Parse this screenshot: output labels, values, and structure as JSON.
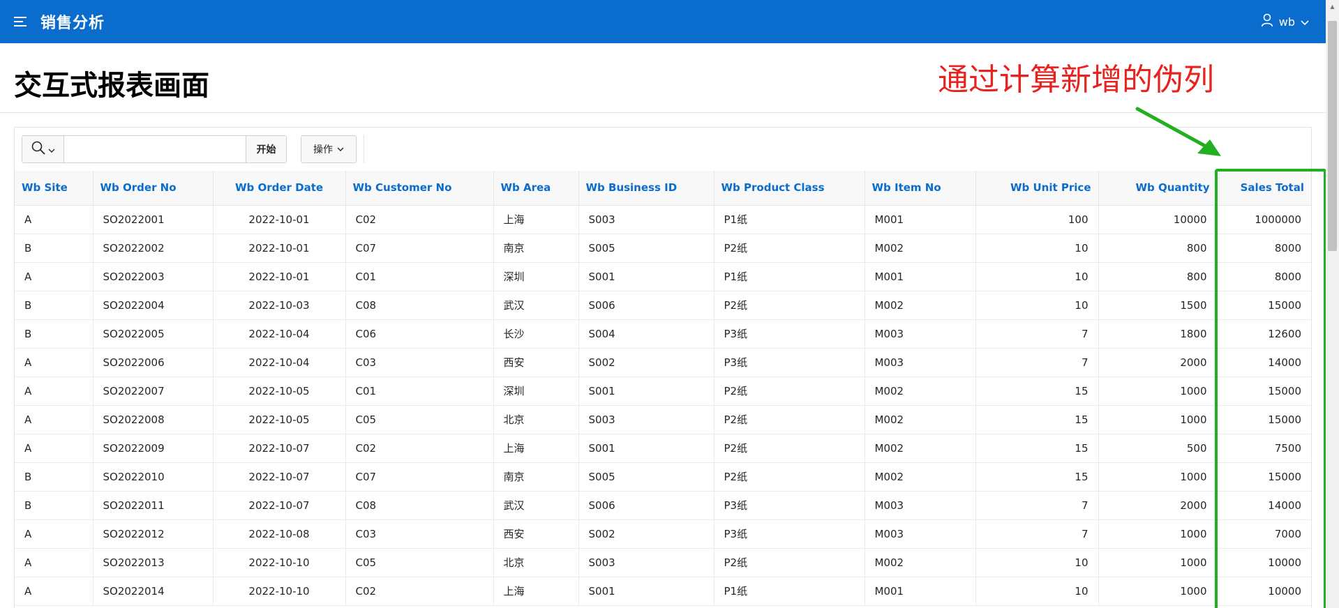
{
  "header": {
    "app_title": "销售分析",
    "menu_icon": "hamburger-menu-icon",
    "user_icon": "user-icon",
    "user_name": "wb",
    "accent_color": "#0a6dcd"
  },
  "page": {
    "title": "交互式报表画面"
  },
  "annotation": {
    "text": "通过计算新增的伪列",
    "text_color": "#e8221f",
    "highlight_color": "#22b022"
  },
  "toolbar": {
    "search_icon": "search-icon",
    "search_value": "",
    "go_label": "开始",
    "actions_label": "操作"
  },
  "table": {
    "columns": [
      {
        "label": "Wb Site",
        "align": "left"
      },
      {
        "label": "Wb Order No",
        "align": "left"
      },
      {
        "label": "Wb Order Date",
        "align": "center"
      },
      {
        "label": "Wb Customer No",
        "align": "left"
      },
      {
        "label": "Wb Area",
        "align": "left"
      },
      {
        "label": "Wb Business ID",
        "align": "left"
      },
      {
        "label": "Wb Product Class",
        "align": "left"
      },
      {
        "label": "Wb Item No",
        "align": "left"
      },
      {
        "label": "Wb Unit Price",
        "align": "right"
      },
      {
        "label": "Wb Quantity",
        "align": "right"
      },
      {
        "label": "Sales Total",
        "align": "right"
      }
    ],
    "rows": [
      [
        "A",
        "SO2022001",
        "2022-10-01",
        "C02",
        "上海",
        "S003",
        "P1纸",
        "M001",
        "100",
        "10000",
        "1000000"
      ],
      [
        "B",
        "SO2022002",
        "2022-10-01",
        "C07",
        "南京",
        "S005",
        "P2纸",
        "M002",
        "10",
        "800",
        "8000"
      ],
      [
        "A",
        "SO2022003",
        "2022-10-01",
        "C01",
        "深圳",
        "S001",
        "P1纸",
        "M001",
        "10",
        "800",
        "8000"
      ],
      [
        "B",
        "SO2022004",
        "2022-10-03",
        "C08",
        "武汉",
        "S006",
        "P2纸",
        "M002",
        "10",
        "1500",
        "15000"
      ],
      [
        "B",
        "SO2022005",
        "2022-10-04",
        "C06",
        "长沙",
        "S004",
        "P3纸",
        "M003",
        "7",
        "1800",
        "12600"
      ],
      [
        "A",
        "SO2022006",
        "2022-10-04",
        "C03",
        "西安",
        "S002",
        "P3纸",
        "M003",
        "7",
        "2000",
        "14000"
      ],
      [
        "A",
        "SO2022007",
        "2022-10-05",
        "C01",
        "深圳",
        "S001",
        "P2纸",
        "M002",
        "15",
        "1000",
        "15000"
      ],
      [
        "A",
        "SO2022008",
        "2022-10-05",
        "C05",
        "北京",
        "S003",
        "P2纸",
        "M002",
        "15",
        "1000",
        "15000"
      ],
      [
        "A",
        "SO2022009",
        "2022-10-07",
        "C02",
        "上海",
        "S001",
        "P2纸",
        "M002",
        "15",
        "500",
        "7500"
      ],
      [
        "B",
        "SO2022010",
        "2022-10-07",
        "C07",
        "南京",
        "S005",
        "P2纸",
        "M002",
        "15",
        "1000",
        "15000"
      ],
      [
        "B",
        "SO2022011",
        "2022-10-07",
        "C08",
        "武汉",
        "S006",
        "P3纸",
        "M003",
        "7",
        "2000",
        "14000"
      ],
      [
        "A",
        "SO2022012",
        "2022-10-08",
        "C03",
        "西安",
        "S002",
        "P3纸",
        "M003",
        "7",
        "1000",
        "7000"
      ],
      [
        "A",
        "SO2022013",
        "2022-10-10",
        "C05",
        "北京",
        "S003",
        "P2纸",
        "M002",
        "10",
        "1000",
        "10000"
      ],
      [
        "A",
        "SO2022014",
        "2022-10-10",
        "C02",
        "上海",
        "S001",
        "P1纸",
        "M001",
        "10",
        "1000",
        "10000"
      ]
    ]
  }
}
